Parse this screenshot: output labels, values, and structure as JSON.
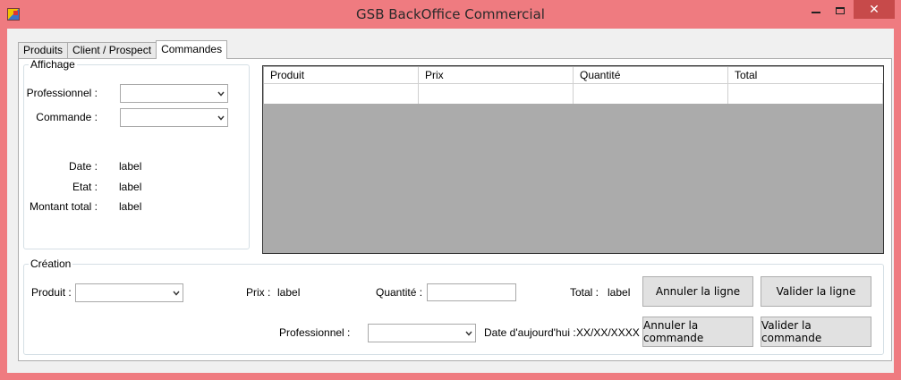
{
  "window": {
    "title": "GSB BackOffice Commercial",
    "close_glyph": "✕"
  },
  "tabs": [
    {
      "label": "Produits"
    },
    {
      "label": "Client / Prospect"
    },
    {
      "label": "Commandes"
    }
  ],
  "affichage": {
    "legend": "Affichage",
    "professionnel_label": "Professionnel :",
    "professionnel_value": "",
    "commande_label": "Commande :",
    "commande_value": "",
    "date_label": "Date :",
    "date_value": "label",
    "etat_label": "Etat :",
    "etat_value": "label",
    "montant_label": "Montant total :",
    "montant_value": "label"
  },
  "grid": {
    "columns": [
      "Produit",
      "Prix",
      "Quantité",
      "Total"
    ],
    "rows": [
      [
        "",
        "",
        "",
        ""
      ]
    ]
  },
  "creation": {
    "legend": "Création",
    "produit_label": "Produit :",
    "produit_value": "",
    "prix_label": "Prix :",
    "prix_value": "label",
    "quantite_label": "Quantité :",
    "quantite_value": "",
    "total_label": "Total :",
    "total_value": "label",
    "annuler_ligne": "Annuler la ligne",
    "valider_ligne": "Valider la ligne",
    "professionnel_label": "Professionnel :",
    "professionnel_value": "",
    "date_label": "Date d'aujourd'hui :",
    "date_value": "XX/XX/XXXX",
    "annuler_commande": "Annuler la commande",
    "valider_commande": "Valider la commande"
  },
  "icons": {
    "app": "app-icon",
    "combo_arrow": "chevron-down-icon"
  }
}
